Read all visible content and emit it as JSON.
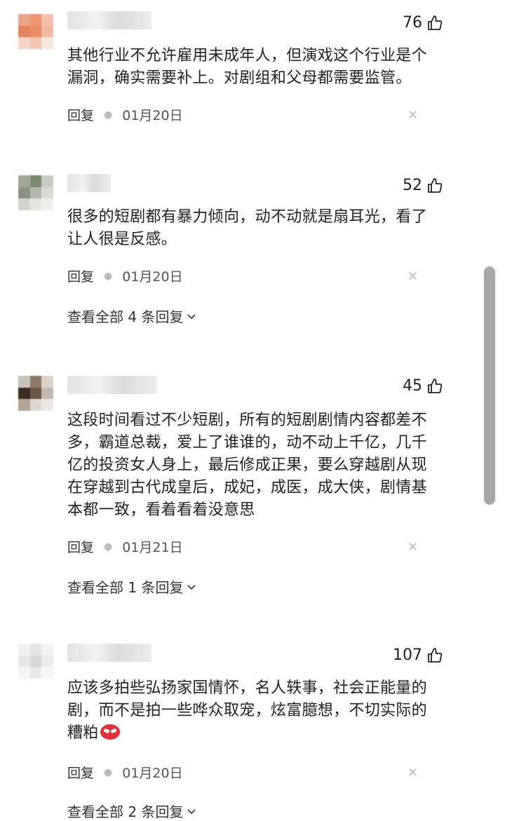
{
  "comments": [
    {
      "likes": "76",
      "lines": [
        "其他行业不允许雇用未成年人，但演戏这个行业是个",
        "漏洞，确实需要补上。对剧组和父母都需要监管。"
      ],
      "reply_label": "回复",
      "date": "01月20日",
      "view_replies": ""
    },
    {
      "likes": "52",
      "lines": [
        "很多的短剧都有暴力倾向，动不动就是扇耳光，看了",
        "让人很是反感。"
      ],
      "reply_label": "回复",
      "date": "01月20日",
      "view_replies": "查看全部 4 条回复"
    },
    {
      "likes": "45",
      "lines": [
        "这段时间看过不少短剧，所有的短剧剧情内容都差不",
        "多，霸道总裁，爱上了谁谁的，动不动上千亿，几千",
        "亿的投资女人身上，最后修成正果，要么穿越剧从现",
        "在穿越到古代成皇后，成妃，成医，成大侠，剧情基",
        "本都一致，看着看着没意思"
      ],
      "reply_label": "回复",
      "date": "01月21日",
      "view_replies": "查看全部 1 条回复"
    },
    {
      "likes": "107",
      "lines": [
        "应该多拍些弘扬家国情怀，名人轶事，社会正能量的",
        "剧，而不是拍一些哗众取宠，炫富臆想，不切实际的",
        "糟粕"
      ],
      "reply_label": "回复",
      "date": "01月20日",
      "view_replies": "查看全部 2 条回复"
    }
  ],
  "icons": {
    "like": "thumbs-up-icon",
    "close": "close-icon",
    "chevron": "chevron-down-icon",
    "emoji": "angry-face-emoji"
  },
  "colors": {
    "text": "#222222",
    "meta": "#555555",
    "close": "#bdbdbd",
    "scrollbar": "#a8a8a8"
  }
}
